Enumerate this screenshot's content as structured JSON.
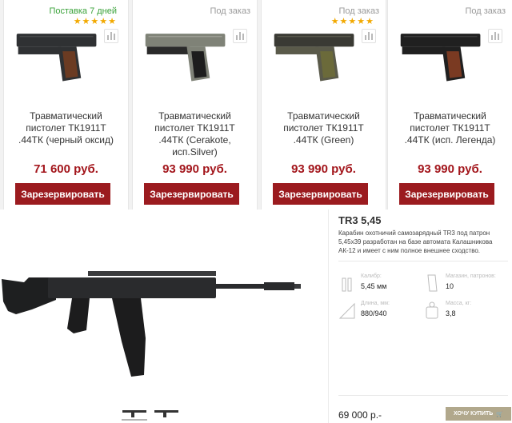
{
  "products": [
    {
      "status": "Поставка 7  дней",
      "status_color": "#3aa23a",
      "has_stars": true,
      "stars": "★★★★★",
      "title_lines": [
        "Травматический",
        "пистолет ТК1911Т",
        ".44ТК (черный оксид)"
      ],
      "price": "71 600 руб.",
      "button": "Зарезервировать",
      "frame_color": "#2f3133",
      "grip_color": "#6b3b22"
    },
    {
      "status": "Под заказ",
      "status_color": "#9a9a9a",
      "has_stars": false,
      "stars": "",
      "title_lines": [
        "Травматический",
        "пистолет ТК1911Т",
        ".44ТК (Cerakote,",
        "исп.Silver)"
      ],
      "price": "93 990 руб.",
      "button": "Зарезервировать",
      "frame_color": "#7f8277",
      "grip_color": "#1d1d1d"
    },
    {
      "status": "Под заказ",
      "status_color": "#9a9a9a",
      "has_stars": true,
      "stars": "★★★★★",
      "title_lines": [
        "Травматический",
        "пистолет ТК1911Т",
        ".44ТК (Green)"
      ],
      "price": "93 990 руб.",
      "button": "Зарезервировать",
      "frame_color": "#5a5a4a",
      "grip_color": "#6b6a3a"
    },
    {
      "status": "Под заказ",
      "status_color": "#9a9a9a",
      "has_stars": false,
      "stars": "",
      "title_lines": [
        "Травматический",
        "пистолет ТК1911Т",
        ".44ТК (исп. Легенда)"
      ],
      "price": "93 990 руб.",
      "button": "Зарезервировать",
      "frame_color": "#202020",
      "grip_color": "#7a3a22"
    }
  ],
  "detail": {
    "name": "TR3 5,45",
    "description": "Карабин охотничий самозарядный TR3 под патрон 5,45х39 разработан на базе автомата Калашникова АК-12 и имеет с ним полное внешнее сходство.",
    "specs": [
      {
        "label": "Калибр:",
        "value": "5,45 мм",
        "icon": "cartridge-icon"
      },
      {
        "label": "Магазин, патронов:",
        "value": "10",
        "icon": "magazine-icon"
      },
      {
        "label": "Длина, мм:",
        "value": "880/940",
        "icon": "ruler-icon"
      },
      {
        "label": "Масса, кг:",
        "value": "3,8",
        "icon": "weight-icon"
      }
    ],
    "price": "69 000 р.-",
    "buy_button": "ХОЧУ КУПИТЬ",
    "cart_icon": "cart-icon",
    "thumbnails": [
      "rifle-thumb-1",
      "rifle-thumb-2"
    ]
  },
  "colors": {
    "accent": "#9b1b1f",
    "price": "#a3161c",
    "buy": "#b1a88c"
  }
}
